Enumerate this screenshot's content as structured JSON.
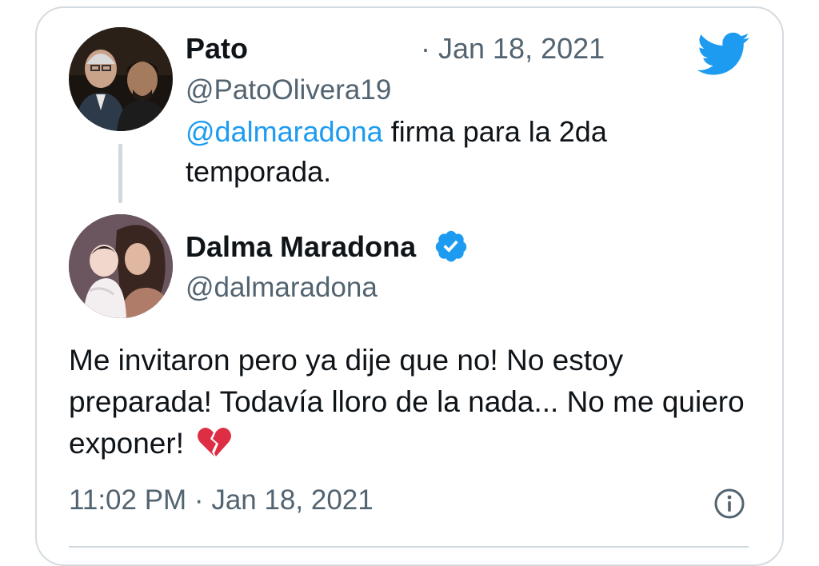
{
  "reply": {
    "name": "Pato",
    "date": "· Jan 18, 2021",
    "handle": "@PatoOlivera19",
    "mention": "@dalmaradona",
    "text": " firma para la 2da temporada."
  },
  "main": {
    "name": "Dalma Maradona",
    "handle": "@dalmaradona",
    "text": "Me invitaron pero ya dije que no! No estoy preparada! Todavía lloro de la nada... No me quiero exponer! ",
    "emoji": "broken-heart-icon",
    "timestamp": "11:02 PM · Jan 18, 2021"
  },
  "colors": {
    "twitter_blue": "#1d9bf0",
    "text_primary": "#0f1419",
    "text_secondary": "#536471",
    "border": "#d4dbe0"
  }
}
